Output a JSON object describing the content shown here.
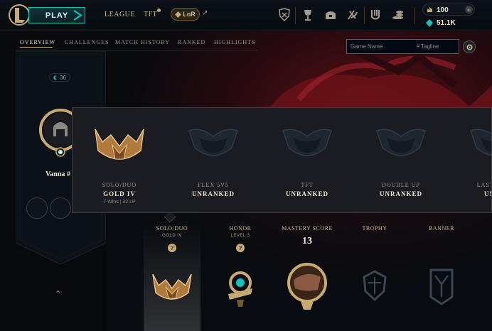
{
  "topbar": {
    "play_label": "PLAY",
    "nav": {
      "league": "LEAGUE",
      "tft": "TFT",
      "lor": "LoR"
    },
    "icons": [
      "clash-icon",
      "ranked-trophy-icon",
      "loot-chest-icon",
      "collection-icon",
      "store-icon",
      "wallet-coins-icon"
    ],
    "currency": {
      "rp": "100",
      "be": "51.1K"
    }
  },
  "tabs": [
    "OVERVIEW",
    "CHALLENGES",
    "MATCH HISTORY",
    "RANKED",
    "HIGHLIGHTS"
  ],
  "search": {
    "game_name_placeholder": "Game Name",
    "tagline_placeholder": "Tagline",
    "hash": "#"
  },
  "profile": {
    "level": "36",
    "summoner_name": "Vanna #"
  },
  "ranked_queues": [
    {
      "queue": "SOLO/DUO",
      "rank": "GOLD IV",
      "stats": "7 Wins | 32 LP"
    },
    {
      "queue": "FLEX 5V5",
      "rank": "UNRANKED",
      "stats": ""
    },
    {
      "queue": "TFT",
      "rank": "UNRANKED",
      "stats": ""
    },
    {
      "queue": "DOUBLE UP",
      "rank": "UNRANKED",
      "stats": ""
    },
    {
      "queue": "LAST SEAS",
      "rank": "UNRA",
      "stats": ""
    }
  ],
  "showcase": {
    "solo": {
      "label": "SOLO/DUO",
      "sub": "GOLD IV",
      "help": "?"
    },
    "honor": {
      "label": "HONOR",
      "sub": "LEVEL 3",
      "help": "?"
    },
    "mastery": {
      "label": "MASTERY SCORE",
      "score": "13"
    },
    "trophy": {
      "label": "TROPHY"
    },
    "banner": {
      "label": "BANNER"
    }
  },
  "colors": {
    "gold": "#c8aa6e",
    "teal": "#0ac8b9",
    "bg": "#010a13",
    "text": "#f0e6d2"
  }
}
